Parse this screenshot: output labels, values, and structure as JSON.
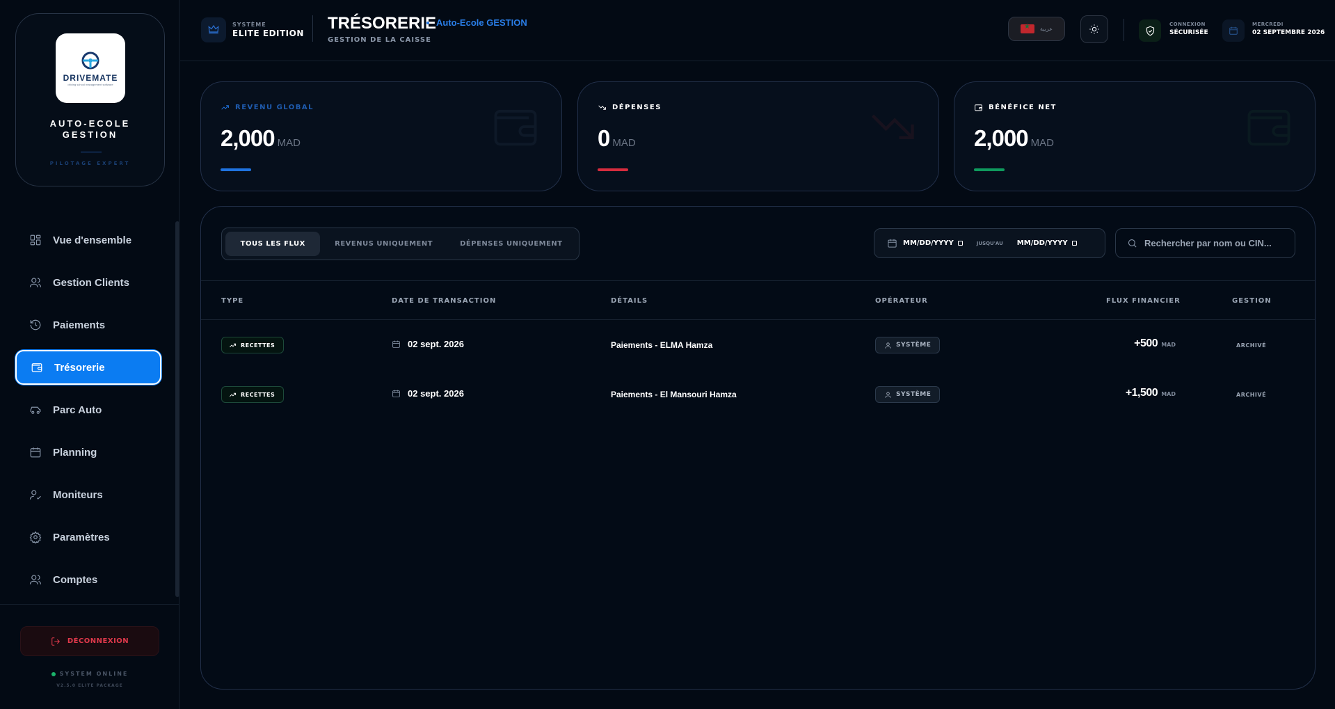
{
  "brand": {
    "logo_text": "DRIVEMATE",
    "logo_tagline": "driving school management software",
    "name": "AUTO-ECOLE GESTION",
    "subtitle": "PILOTAGE EXPERT"
  },
  "nav": {
    "items": [
      {
        "label": "Vue d'ensemble",
        "icon": "grid-icon"
      },
      {
        "label": "Gestion Clients",
        "icon": "users-icon"
      },
      {
        "label": "Paiements",
        "icon": "history-icon"
      },
      {
        "label": "Trésorerie",
        "icon": "wallet-icon",
        "active": true
      },
      {
        "label": "Parc Auto",
        "icon": "car-icon"
      },
      {
        "label": "Planning",
        "icon": "calendar-icon"
      },
      {
        "label": "Moniteurs",
        "icon": "user-check-icon"
      },
      {
        "label": "Paramètres",
        "icon": "gear-icon"
      },
      {
        "label": "Comptes",
        "icon": "users-icon"
      }
    ]
  },
  "sidebar_footer": {
    "logout_label": "DÉCONNEXION",
    "status": "SYSTEM ONLINE",
    "version": "V2.5.0 ELITE PACKAGE"
  },
  "header": {
    "system_label": "SYSTÈME",
    "system_value": "ELITE EDITION",
    "title": "TRÉSORERIE",
    "context": "Auto-Ecole GESTION",
    "subtitle": "GESTION DE LA CAISSE",
    "language_label": "عربية",
    "connection_label": "CONNEXION",
    "connection_value": "SÉCURISÉE",
    "day_label": "MERCREDI",
    "date_value": "02 SEPTEMBRE 2026"
  },
  "stats": [
    {
      "label": "REVENU GLOBAL",
      "value": "2,000",
      "unit": "MAD",
      "color": "#1f73e0",
      "icon": "trending-up-icon"
    },
    {
      "label": "DÉPENSES",
      "value": "0",
      "unit": "MAD",
      "color": "#d62c3e",
      "icon": "trending-down-icon"
    },
    {
      "label": "BÉNÉFICE NET",
      "value": "2,000",
      "unit": "MAD",
      "color": "#0f9a5e",
      "icon": "wallet-icon"
    }
  ],
  "filters": {
    "tabs": [
      "TOUS LES FLUX",
      "REVENUS UNIQUEMENT",
      "DÉPENSES UNIQUEMENT"
    ],
    "active_tab": "TOUS LES FLUX",
    "date_from_placeholder": "MM/DD/YYYY",
    "date_to_placeholder": "MM/DD/YYYY",
    "date_separator": "JUSQU'AU",
    "search_placeholder": "Rechercher par nom ou CIN..."
  },
  "table": {
    "columns": [
      "TYPE",
      "DATE DE TRANSACTION",
      "DÉTAILS",
      "OPÉRATEUR",
      "FLUX FINANCIER",
      "GESTION"
    ],
    "rows": [
      {
        "type": "RECETTES",
        "date": "02 sept. 2026",
        "details": "Paiements - ELMA Hamza",
        "operator": "SYSTÈME",
        "amount": "+500",
        "unit": "MAD",
        "status": "ARCHIVÉ"
      },
      {
        "type": "RECETTES",
        "date": "02 sept. 2026",
        "details": "Paiements - El Mansouri Hamza",
        "operator": "SYSTÈME",
        "amount": "+1,500",
        "unit": "MAD",
        "status": "ARCHIVÉ"
      }
    ]
  }
}
